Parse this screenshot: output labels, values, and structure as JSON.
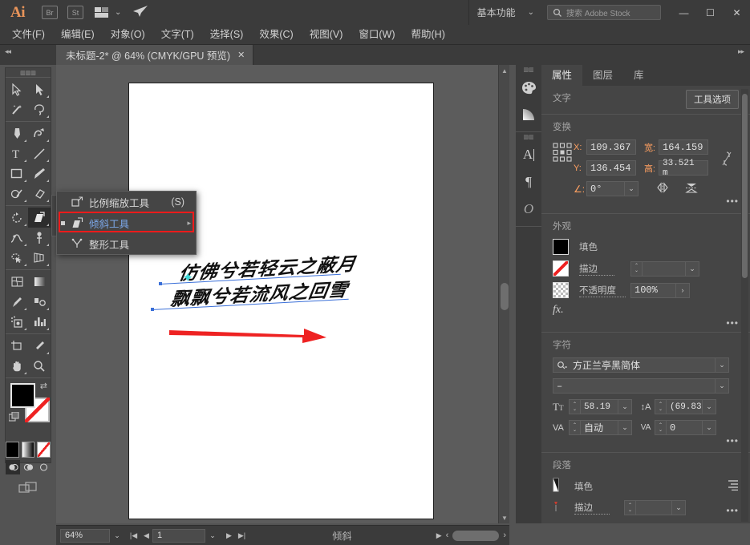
{
  "app": {
    "name": "Adobe Illustrator",
    "logo_text": "Ai",
    "bridge_label": "Br",
    "stock_label": "St"
  },
  "appbar": {
    "workspace": "基本功能",
    "workspace_chevron": "⌄",
    "search_placeholder": "搜索 Adobe Stock",
    "search_icon": "search-icon",
    "minimize": "—",
    "maximize": "☐",
    "close": "✕"
  },
  "menubar": {
    "items": [
      {
        "label": "文件(F)"
      },
      {
        "label": "编辑(E)"
      },
      {
        "label": "对象(O)"
      },
      {
        "label": "文字(T)"
      },
      {
        "label": "选择(S)"
      },
      {
        "label": "效果(C)"
      },
      {
        "label": "视图(V)"
      },
      {
        "label": "窗口(W)"
      },
      {
        "label": "帮助(H)"
      }
    ]
  },
  "tabbar": {
    "collapse_left": "◂◂",
    "collapse_right": "▸▸",
    "document_title": "未标题-2* @ 64% (CMYK/GPU 预览)",
    "close_glyph": "✕"
  },
  "toolbar": {
    "groups": [
      {
        "tools": [
          {
            "name": "selection-tool",
            "glyph": "selection"
          },
          {
            "name": "direct-selection-tool",
            "glyph": "direct-selection"
          },
          {
            "name": "magic-wand-tool",
            "glyph": "magic-wand"
          },
          {
            "name": "lasso-tool",
            "glyph": "lasso"
          }
        ]
      },
      {
        "tools": [
          {
            "name": "pen-tool",
            "glyph": "pen"
          },
          {
            "name": "curvature-tool",
            "glyph": "curvature"
          },
          {
            "name": "type-tool",
            "glyph": "type"
          },
          {
            "name": "line-segment-tool",
            "glyph": "line"
          },
          {
            "name": "rectangle-tool",
            "glyph": "rectangle"
          },
          {
            "name": "paintbrush-tool",
            "glyph": "paintbrush"
          },
          {
            "name": "shaper-tool",
            "glyph": "shaper"
          },
          {
            "name": "eraser-tool",
            "glyph": "eraser"
          }
        ]
      },
      {
        "tools": [
          {
            "name": "rotate-tool",
            "glyph": "rotate"
          },
          {
            "name": "shear-tool",
            "glyph": "shear"
          },
          {
            "name": "width-tool",
            "glyph": "width"
          },
          {
            "name": "free-transform-tool",
            "glyph": "free-transform"
          },
          {
            "name": "shape-builder-tool",
            "glyph": "shape-builder"
          },
          {
            "name": "perspective-grid-tool",
            "glyph": "perspective"
          }
        ]
      },
      {
        "tools": [
          {
            "name": "mesh-tool",
            "glyph": "mesh"
          },
          {
            "name": "gradient-tool",
            "glyph": "gradient"
          },
          {
            "name": "eyedropper-tool",
            "glyph": "eyedropper"
          },
          {
            "name": "blend-tool",
            "glyph": "blend"
          },
          {
            "name": "symbol-sprayer-tool",
            "glyph": "symbol-sprayer"
          },
          {
            "name": "column-graph-tool",
            "glyph": "column-graph"
          }
        ]
      },
      {
        "tools": [
          {
            "name": "artboard-tool",
            "glyph": "artboard"
          },
          {
            "name": "slice-tool",
            "glyph": "slice"
          },
          {
            "name": "hand-tool",
            "glyph": "hand"
          },
          {
            "name": "zoom-tool",
            "glyph": "zoom"
          }
        ]
      }
    ],
    "active_tool": "shear-tool",
    "fill_color": "#000000",
    "stroke_color": "none",
    "swap_glyph": "⇄"
  },
  "mini_panel": {
    "expand_glyph": "▸▸",
    "close_glyph": "✕",
    "items": [
      {
        "name": "transform-panel-icon"
      },
      {
        "name": "align-panel-icon"
      },
      {
        "name": "pathfinder-panel-icon"
      }
    ]
  },
  "flyout_menu": {
    "items": [
      {
        "label": "比例缩放工具",
        "shortcut": "(S)",
        "icon": "scale-tool-icon",
        "selected": false,
        "submenu": false
      },
      {
        "label": "倾斜工具",
        "shortcut": "",
        "icon": "shear-tool-icon",
        "selected": true,
        "submenu": true
      },
      {
        "label": "整形工具",
        "shortcut": "",
        "icon": "reshape-tool-icon",
        "selected": false,
        "submenu": false
      }
    ],
    "highlight_color": "#ee1b1b"
  },
  "canvas": {
    "artwork": {
      "line1": "仿佛兮若轻云之蔽月",
      "line2": "飘飘兮若流风之回雪",
      "anchor_glyph": "✦",
      "arrow_color": "#ee2222"
    }
  },
  "statusbar": {
    "zoom_level": "64%",
    "zoom_chevron": "⌄",
    "first_glyph": "|◀",
    "prev_glyph": "◀",
    "page_number": "1",
    "page_chevron": "⌄",
    "next_glyph": "▶",
    "last_glyph": "▶|",
    "status_text": "倾斜",
    "play_glyph": "▶",
    "left_glyph": "‹",
    "right_glyph": "›"
  },
  "rail": {
    "groups": [
      {
        "items": [
          {
            "name": "swatches-panel-icon"
          },
          {
            "name": "gradient-panel-icon"
          }
        ]
      },
      {
        "items": [
          {
            "name": "character-panel-icon",
            "glyph": "A"
          },
          {
            "name": "paragraph-panel-icon",
            "glyph": "¶"
          },
          {
            "name": "opentype-panel-icon",
            "glyph": "O"
          }
        ]
      }
    ]
  },
  "panel": {
    "tabs": [
      {
        "label": "属性",
        "active": true
      },
      {
        "label": "图层",
        "active": false
      },
      {
        "label": "库",
        "active": false
      }
    ],
    "type_section": {
      "title": "文字",
      "tool_options_button": "工具选项"
    },
    "transform": {
      "title": "变换",
      "x_label": "X:",
      "x_value": "109.367",
      "y_label": "Y:",
      "y_value": "136.454",
      "w_label": "宽:",
      "w_value": "164.159",
      "h_label": "高:",
      "h_value": "33.521 m",
      "angle_label": "∠:",
      "angle_value": "0°",
      "link_icon": "link-broken-icon",
      "flip_h_icon": "flip-horizontal-icon",
      "flip_v_icon": "flip-vertical-icon",
      "more_glyph": "•••"
    },
    "appearance": {
      "title": "外观",
      "fill_label": "填色",
      "stroke_label": "描边",
      "stroke_weight": "",
      "opacity_label": "不透明度",
      "opacity_value": "100%",
      "opacity_chevron": "›",
      "fx_label": "fx.",
      "more_glyph": "•••"
    },
    "character": {
      "title": "字符",
      "font_family": "方正兰亭黑简体",
      "font_style": "–",
      "size_icon": "font-size-icon",
      "size_value": "58.19 ",
      "leading_icon": "leading-icon",
      "leading_value": "(69.83",
      "kerning_icon": "kerning-icon",
      "kerning_value": "自动",
      "tracking_icon": "tracking-icon",
      "tracking_value": "0",
      "search_icon": "font-search-icon",
      "more_glyph": "•••"
    },
    "paragraph": {
      "title": "段落",
      "fill_label": "填色",
      "stroke_label": "描边",
      "stroke_weight": "",
      "align_icon": "align-paragraph-icon",
      "more_glyph": "•••"
    }
  },
  "colors": {
    "panel_bg": "#454545",
    "chrome_bg": "#3b3b3b",
    "canvas_bg": "#5c5c5c",
    "accent_orange": "#ffa061",
    "selected_blue": "#7ba7e8",
    "highlight_red": "#ee1b1b"
  }
}
